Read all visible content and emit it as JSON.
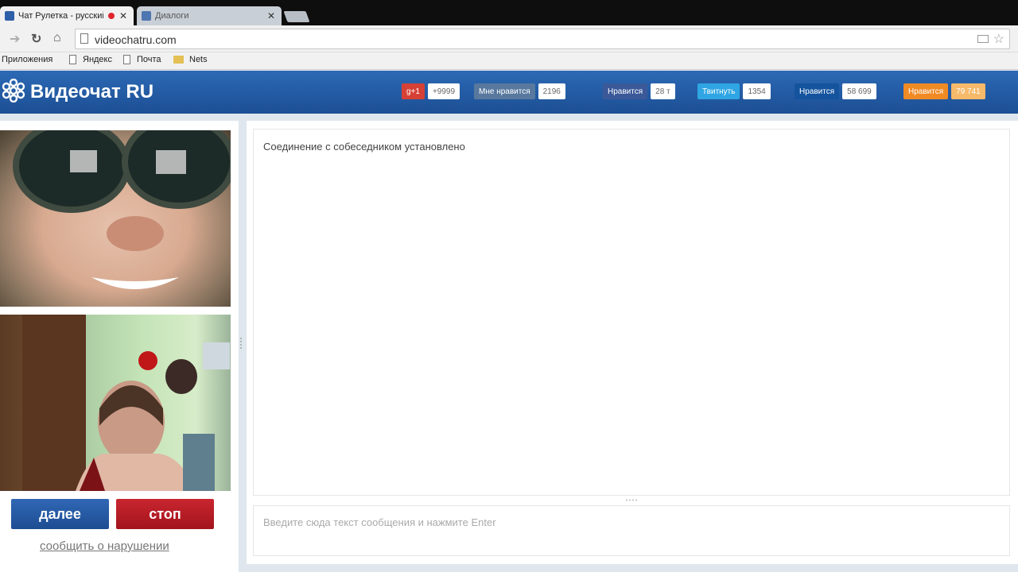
{
  "browser": {
    "tabs": [
      {
        "title": "Чат Рулетка - русский",
        "active": true
      },
      {
        "title": "Диалоги",
        "active": false
      }
    ],
    "url": "videochatru.com",
    "bookmarks": [
      {
        "label": "Приложения",
        "icon": "apps-icon"
      },
      {
        "label": "Яндекс",
        "icon": "page-icon"
      },
      {
        "label": "Почта",
        "icon": "page-icon"
      },
      {
        "label": "Nets",
        "icon": "folder-icon"
      }
    ]
  },
  "site": {
    "brand": "Видеочат RU",
    "share_buttons": [
      {
        "name": "gplus",
        "label": "g+1",
        "count": "+9999",
        "color": "#d64136"
      },
      {
        "name": "vk",
        "label": "Мне нравится",
        "count": "2196",
        "color": "#58789e"
      },
      {
        "name": "facebook",
        "label": "Нравится",
        "count": "28 т",
        "color": "#3b5998"
      },
      {
        "name": "twitter",
        "label": "Твитнуть",
        "count": "1354",
        "color": "#2fa5e3"
      },
      {
        "name": "mailru",
        "label": "Нравится",
        "count": "58 699",
        "color": "#14539e"
      },
      {
        "name": "odnoklassniki",
        "label": "Нравится",
        "count": "79 741",
        "color": "#f08a24"
      }
    ]
  },
  "controls": {
    "next_label": "далее",
    "stop_label": "стоп",
    "report_label": "сообщить о нарушении"
  },
  "chat": {
    "system_message": "Соединение с собеседником установлено",
    "input_placeholder": "Введите сюда текст сообщения и нажмите Enter",
    "input_value": ""
  },
  "colors": {
    "header_blue": "#1f5aa6",
    "next_blue": "#2759a3",
    "stop_red": "#b71c25"
  }
}
